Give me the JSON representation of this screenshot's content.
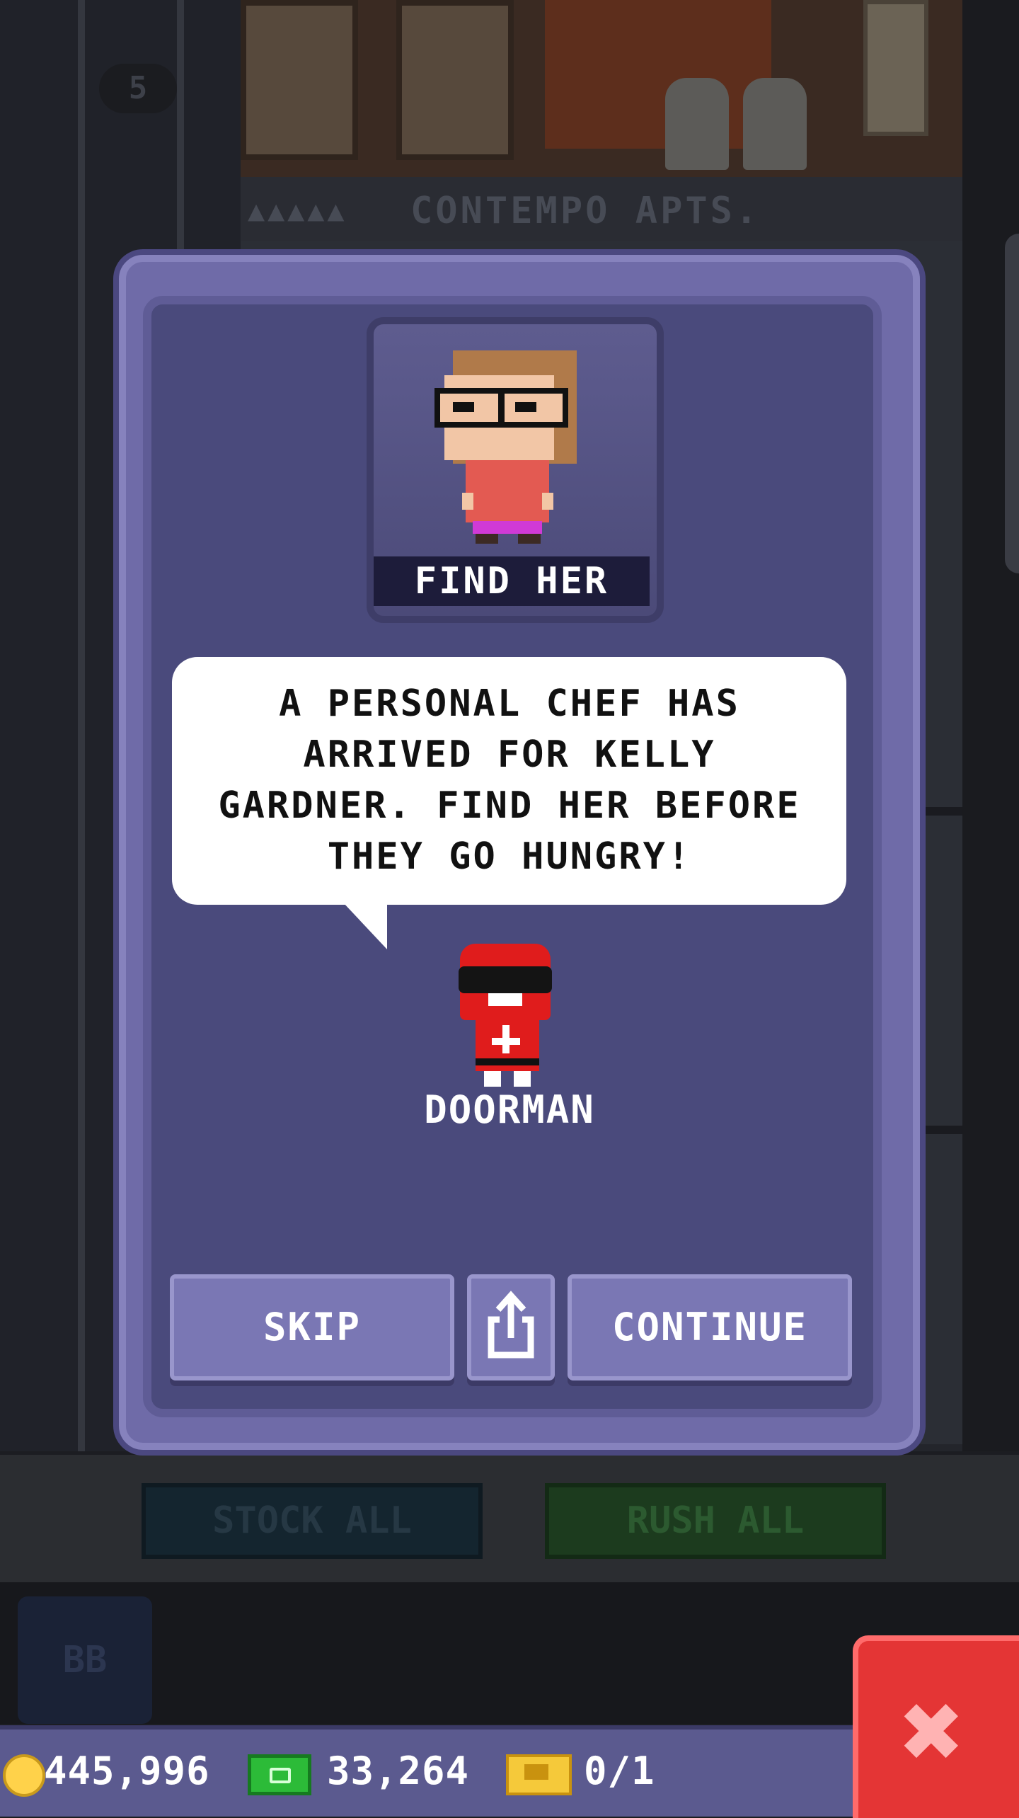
{
  "background": {
    "floor_number": "5",
    "floor_name": "CONTEMPO APTS.",
    "floor_dots": "▲▲▲▲▲"
  },
  "toolbar": {
    "stock_all": "STOCK ALL",
    "rush_all": "RUSH ALL",
    "bb_label": "BB"
  },
  "status": {
    "coins": "445,996",
    "bux": "33,264",
    "tickets": "0/1"
  },
  "dialog": {
    "portrait_label": "FIND HER",
    "message": "A PERSONAL CHEF HAS\nARRIVED FOR KELLY\nGARDNER. FIND HER BEFORE\nTHEY GO HUNGRY!",
    "speaker": "DOORMAN",
    "buttons": {
      "skip": "SKIP",
      "continue": "CONTINUE"
    }
  },
  "colors": {
    "dialog_frame": "#6f6ba8",
    "dialog_inner": "#4a4a7c",
    "button": "#7a77b4",
    "close_red": "#e43535"
  }
}
